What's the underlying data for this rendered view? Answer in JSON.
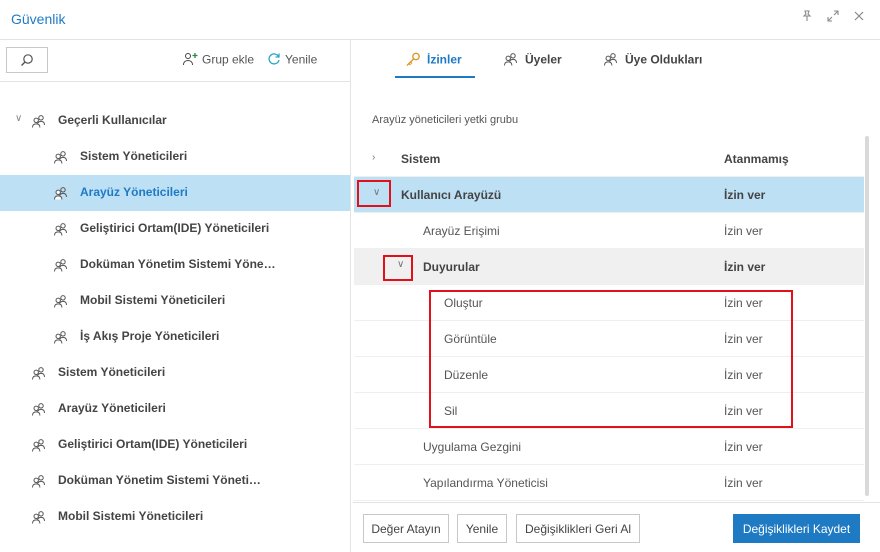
{
  "window": {
    "title": "Güvenlik"
  },
  "toolbar": {
    "add_group": "Grup ekle",
    "refresh": "Yenile"
  },
  "tree": [
    {
      "label": "Geçerli Kullanıcılar",
      "level": 0,
      "expanded": true
    },
    {
      "label": "Sistem Yöneticileri",
      "level": 1
    },
    {
      "label": "Arayüz Yöneticileri",
      "level": 1,
      "selected": true
    },
    {
      "label": "Geliştirici Ortam(IDE) Yöneticileri",
      "level": 1
    },
    {
      "label": "Doküman Yönetim Sistemi Yöne…",
      "level": 1
    },
    {
      "label": "Mobil Sistemi Yöneticileri",
      "level": 1
    },
    {
      "label": "İş Akış Proje Yöneticileri",
      "level": 1
    },
    {
      "label": "Sistem Yöneticileri",
      "level": 0
    },
    {
      "label": "Arayüz Yöneticileri",
      "level": 0
    },
    {
      "label": "Geliştirici Ortam(IDE) Yöneticileri",
      "level": 0
    },
    {
      "label": "Doküman Yönetim Sistemi Yöneti…",
      "level": 0
    },
    {
      "label": "Mobil Sistemi Yöneticileri",
      "level": 0
    }
  ],
  "tabs": [
    {
      "label": "İzinler",
      "active": true
    },
    {
      "label": "Üyeler"
    },
    {
      "label": "Üye Oldukları"
    }
  ],
  "group_description": "Arayüz yöneticileri yetki grubu",
  "grid": {
    "headers": {
      "name": "Sistem",
      "value": "Atanmamış"
    },
    "rows": [
      {
        "name": "Kullanıcı Arayüzü",
        "value": "İzin ver",
        "level": 0,
        "bold": true,
        "highlight": true,
        "expanded": true
      },
      {
        "name": "Arayüz Erişimi",
        "value": "İzin ver",
        "level": 1
      },
      {
        "name": "Duyurular",
        "value": "İzin ver",
        "level": 1,
        "bold": true,
        "grey": true,
        "expanded": true
      },
      {
        "name": "Oluştur",
        "value": "İzin ver",
        "level": 2
      },
      {
        "name": "Görüntüle",
        "value": "İzin ver",
        "level": 2
      },
      {
        "name": "Düzenle",
        "value": "İzin ver",
        "level": 2
      },
      {
        "name": "Sil",
        "value": "İzin ver",
        "level": 2
      },
      {
        "name": "Uygulama Gezgini",
        "value": "İzin ver",
        "level": 1
      },
      {
        "name": "Yapılandırma Yöneticisi",
        "value": "İzin ver",
        "level": 1
      }
    ]
  },
  "buttons": {
    "assign": "Değer Atayın",
    "refresh": "Yenile",
    "revert": "Değişiklikleri Geri Al",
    "save": "Değişiklikleri Kaydet"
  },
  "colors": {
    "accent": "#1f7ac4",
    "selection": "#bde0f5",
    "annotation": "#e0111b"
  }
}
